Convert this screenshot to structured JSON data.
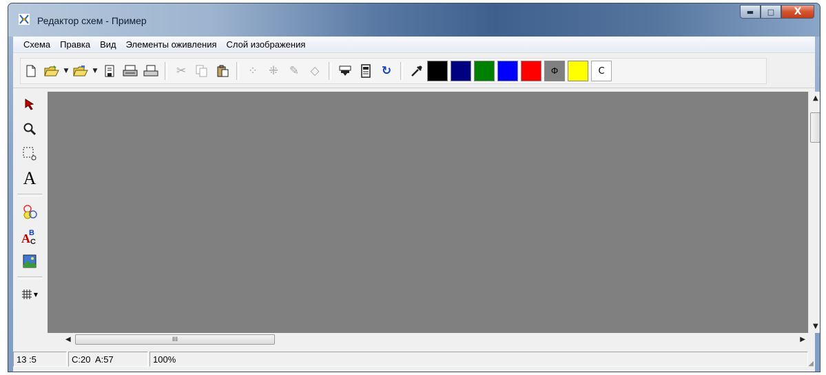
{
  "window": {
    "title": "Редактор схем - Пример",
    "caption_buttons": {
      "minimize": "▬",
      "maximize": "□",
      "close": "X"
    }
  },
  "menu": {
    "items": [
      "Схема",
      "Правка",
      "Вид",
      "Элементы оживления",
      "Слой изображения"
    ]
  },
  "toolbar": {
    "colors": {
      "black": "#000000",
      "navy": "#000080",
      "green": "#008000",
      "blue": "#0000ff",
      "red": "#ff0000",
      "gray": "#808080",
      "yellow": "#ffff00",
      "white": "#ffffff"
    },
    "gray_swatch_label": "Ф",
    "current_color_label": "C"
  },
  "canvas": {
    "background": "#808080"
  },
  "scrollbar": {
    "thumb_grip": "III"
  },
  "status": {
    "coords": "13 :5",
    "counts": "C:20  A:57",
    "zoom": "100%"
  }
}
